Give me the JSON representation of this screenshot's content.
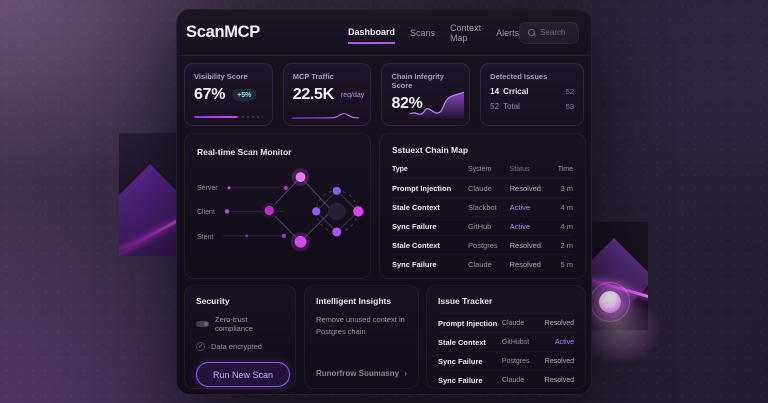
{
  "app": {
    "title": "ScanMCP"
  },
  "nav": {
    "items": [
      {
        "label": "Dashboard",
        "active": true
      },
      {
        "label": "Scans",
        "active": false
      },
      {
        "label": "Context Map",
        "active": false
      },
      {
        "label": "Alerts",
        "active": false
      }
    ],
    "search_placeholder": "Search"
  },
  "stats": {
    "visibility": {
      "title": "Visibility Score",
      "value": "67%",
      "badge": "+5%",
      "progress_pct": 62
    },
    "traffic": {
      "title": "MCP Traffic",
      "value": "22.5K",
      "unit": "req/day"
    },
    "integrity": {
      "title": "Chain Infegrity Score",
      "value": "82%"
    },
    "issues": {
      "title": "Detected Issues",
      "rows": [
        {
          "num": "14",
          "label": "Crrical",
          "value": "52"
        },
        {
          "num": "52",
          "label": "Total",
          "value": "53"
        }
      ]
    }
  },
  "monitor": {
    "title": "Real-time Scan Monitor",
    "labels": [
      "Server",
      "Client",
      "Stent"
    ]
  },
  "chain_map": {
    "title": "Sstuext Chain Map",
    "columns": [
      "Type",
      "System",
      "Status",
      "Time"
    ],
    "rows": [
      {
        "type": "Prompt Injection",
        "system": "Claude",
        "status": "Resolved",
        "time": "3 m"
      },
      {
        "type": "Stale Context",
        "system": "Slackbot",
        "status": "Active",
        "time": "4 m"
      },
      {
        "type": "Sync Failure",
        "system": "GitHub",
        "status": "Active",
        "time": "4 m"
      },
      {
        "type": "Stale Context",
        "system": "Postgres",
        "status": "Resolved",
        "time": "2 m"
      },
      {
        "type": "Sync Failure",
        "system": "Claude",
        "status": "Resolved",
        "time": "5 m"
      }
    ]
  },
  "security": {
    "title": "Security",
    "items": [
      "Zero-trust compliance",
      "Data encrypted"
    ],
    "check_glyph": "✓",
    "button": "Run New Scan"
  },
  "insights": {
    "title": "Intelligent Insights",
    "body": "Remove unused context in Postgres chain",
    "link": "Runorfrow Soumasny",
    "chevron_glyph": "›"
  },
  "tracker": {
    "title": "Issue Tracker",
    "rows": [
      {
        "type": "Prompt Injection",
        "system": "Claude",
        "status": "Resolved"
      },
      {
        "type": "Stale Context",
        "system": "GitHubst",
        "status": "Active"
      },
      {
        "type": "Sync Failure",
        "system": "Postgres",
        "status": "Resolved"
      },
      {
        "type": "Sync Failure",
        "system": "Claude",
        "status": "Resolved"
      }
    ]
  },
  "colors": {
    "accent_purple": "#a855f7",
    "magenta": "#d946ef",
    "teal_badge": "#7de3f4",
    "active_status": "#a78bfa"
  }
}
